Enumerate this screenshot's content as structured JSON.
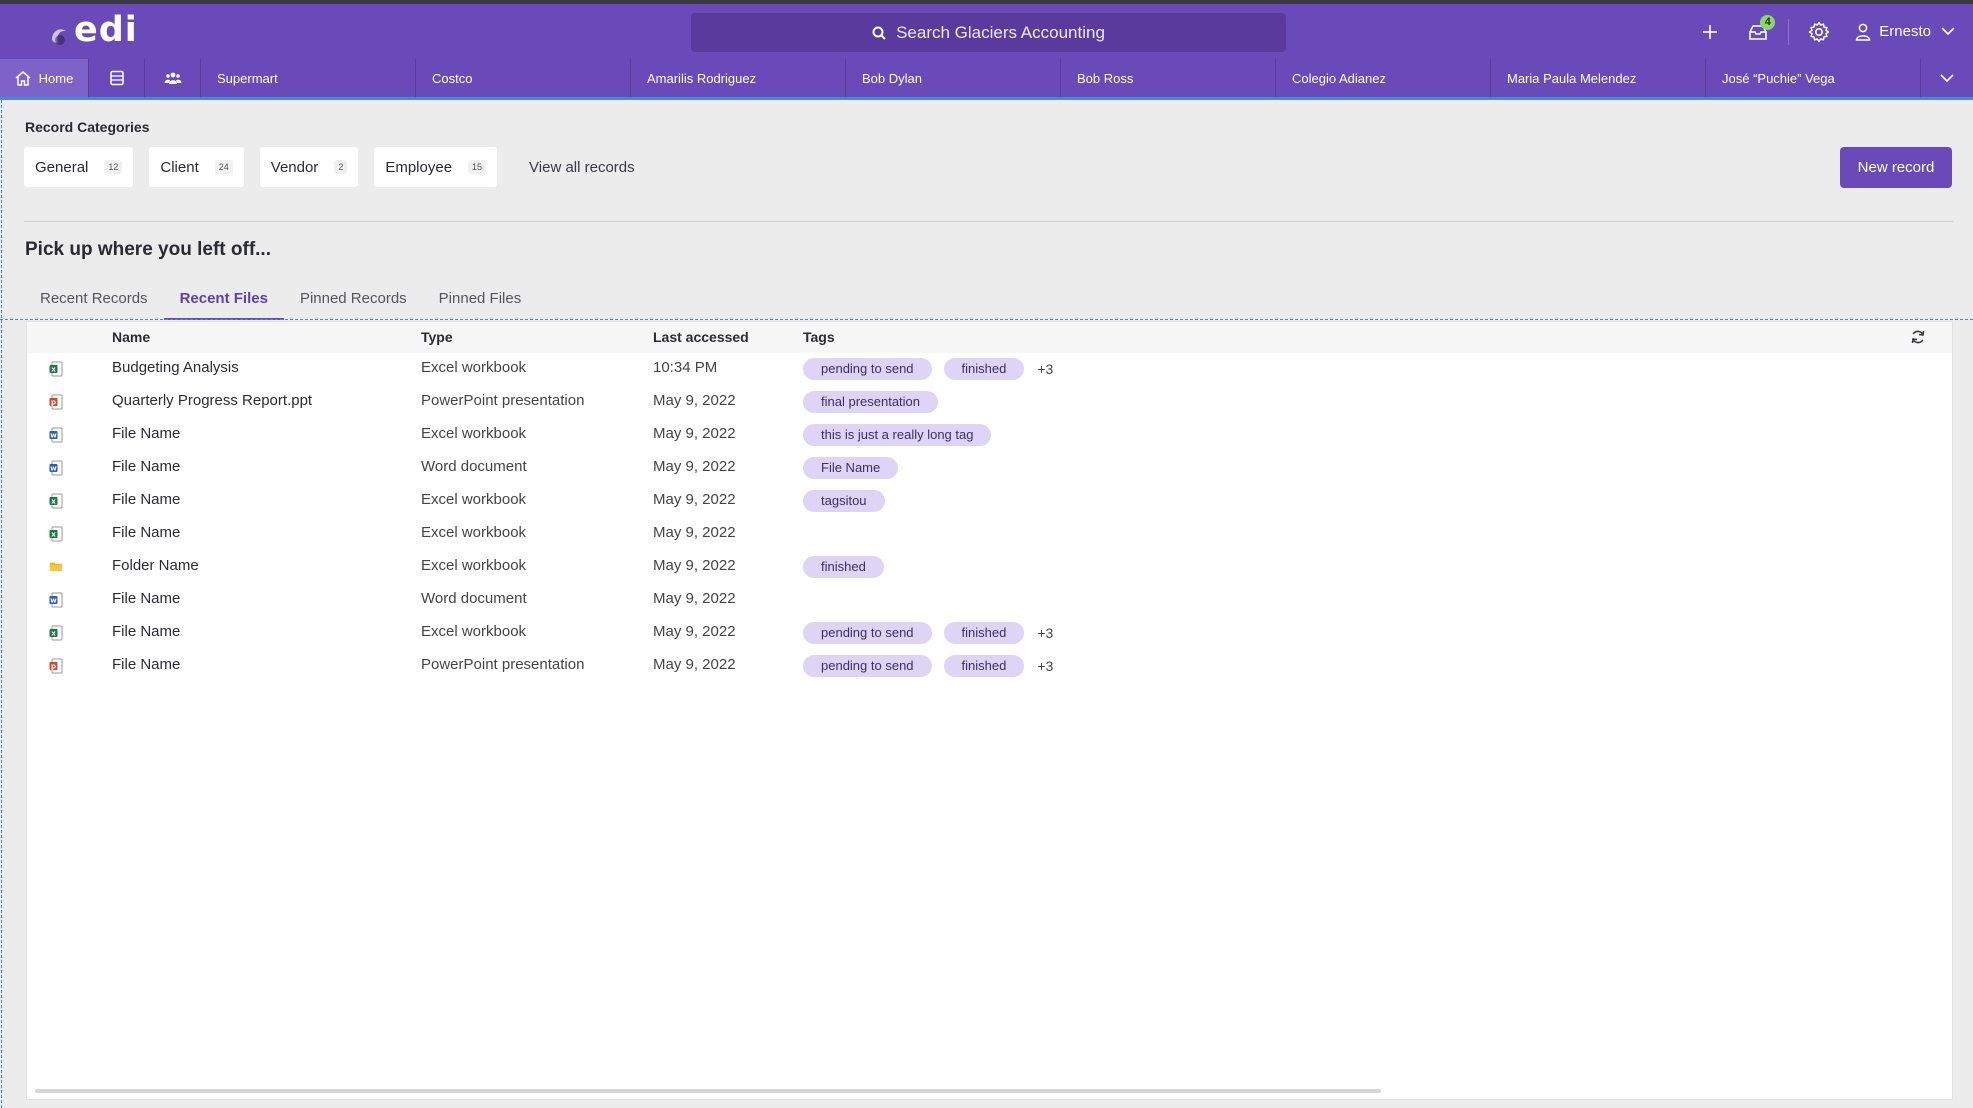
{
  "app": {
    "logo_text": "edi",
    "user_name": "Ernesto",
    "notification_count": "4"
  },
  "search": {
    "placeholder": "Search Glaciers Accounting"
  },
  "nav": {
    "home_label": "Home",
    "tabs": [
      "Supermart",
      "Costco",
      "Amarilis Rodriguez",
      "Bob Dylan",
      "Bob Ross",
      "Colegio Adianez",
      "Maria Paula Melendez",
      "José “Puchie” Vega"
    ]
  },
  "categories": {
    "title": "Record Categories",
    "items": [
      {
        "label": "General",
        "count": "12"
      },
      {
        "label": "Client",
        "count": "24"
      },
      {
        "label": "Vendor",
        "count": "2"
      },
      {
        "label": "Employee",
        "count": "15"
      }
    ],
    "view_all": "View all records",
    "new_record": "New record"
  },
  "pickup": {
    "title": "Pick up where you left off...",
    "tabs": [
      "Recent Records",
      "Recent Files",
      "Pinned Records",
      "Pinned Files"
    ],
    "active_tab": "Recent Files"
  },
  "table": {
    "columns": [
      "Name",
      "Type",
      "Last accessed",
      "Tags"
    ],
    "rows": [
      {
        "icon": "excel-file-icon",
        "name": "Budgeting Analysis",
        "type": "Excel workbook",
        "date": "10:34 PM",
        "tags": [
          "pending to send",
          "finished"
        ],
        "more": "+3"
      },
      {
        "icon": "powerpoint-file-icon",
        "name": "Quarterly Progress Report.ppt",
        "type": "PowerPoint presentation",
        "date": "May 9, 2022",
        "tags": [
          "final presentation"
        ],
        "more": ""
      },
      {
        "icon": "word-file-icon",
        "name": "File Name",
        "type": "Excel workbook",
        "date": "May 9, 2022",
        "tags": [
          "this is just a really long tag"
        ],
        "more": ""
      },
      {
        "icon": "word-file-icon",
        "name": "File Name",
        "type": "Word document",
        "date": "May 9, 2022",
        "tags": [
          "File Name"
        ],
        "more": ""
      },
      {
        "icon": "excel-file-icon",
        "name": "File Name",
        "type": "Excel workbook",
        "date": "May 9, 2022",
        "tags": [
          "tagsitou"
        ],
        "more": ""
      },
      {
        "icon": "excel-file-icon",
        "name": "File Name",
        "type": "Excel workbook",
        "date": "May 9, 2022",
        "tags": [],
        "more": ""
      },
      {
        "icon": "folder-icon",
        "name": "Folder Name",
        "type": "Excel workbook",
        "date": "May 9, 2022",
        "tags": [
          "finished"
        ],
        "more": ""
      },
      {
        "icon": "word-file-icon",
        "name": "File Name",
        "type": "Word document",
        "date": "May 9, 2022",
        "tags": [],
        "more": ""
      },
      {
        "icon": "excel-file-icon",
        "name": "File Name",
        "type": "Excel workbook",
        "date": "May 9, 2022",
        "tags": [
          "pending to send",
          "finished"
        ],
        "more": "+3"
      },
      {
        "icon": "powerpoint-file-icon",
        "name": "File Name",
        "type": "PowerPoint presentation",
        "date": "May 9, 2022",
        "tags": [
          "pending to send",
          "finished"
        ],
        "more": "+3"
      }
    ]
  },
  "colors": {
    "brand": "#6a4ab8",
    "tag_bg": "#ddd4f6",
    "badge": "#8ed66a",
    "excel": "#1f7a43",
    "word": "#2b5fb8",
    "powerpoint": "#d04a2a",
    "folder": "#f2b21c"
  }
}
